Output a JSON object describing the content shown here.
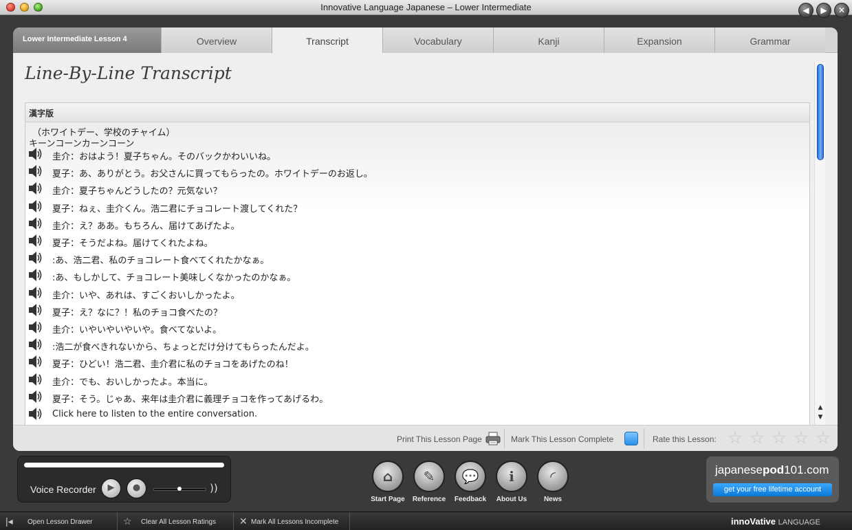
{
  "window": {
    "title": "Innovative Language Japanese – Lower Intermediate",
    "back_icon": "back-arrow",
    "forward_icon": "forward-arrow",
    "close_icon": "close-x"
  },
  "tabs": {
    "lesson_label": "Lower Intermediate Lesson 4",
    "items": [
      {
        "label": "Overview"
      },
      {
        "label": "Transcript"
      },
      {
        "label": "Vocabulary"
      },
      {
        "label": "Kanji"
      },
      {
        "label": "Expansion"
      },
      {
        "label": "Grammar"
      }
    ],
    "active": "Transcript"
  },
  "main": {
    "heading": "Line-By-Line Transcript",
    "box_header": "漢字版",
    "intro_lines": [
      "（ホワイトデー、学校のチャイム）",
      "キーンコーンカーンコーン"
    ],
    "lines": [
      "圭介：おはよう！夏子ちゃん。そのバックかわいいね。",
      "夏子：あ、ありがとう。お父さんに買ってもらったの。ホワイトデーのお返し。",
      "圭介：夏子ちゃんどうしたの？元気ない？",
      "夏子：ねぇ、圭介くん。浩二君にチョコレート渡してくれた？",
      "圭介：え？ああ。もちろん、届けてあげたよ。",
      "夏子：そうだよね。届けてくれたよね。",
      ":あ、浩二君、私のチョコレート食べてくれたかなぁ。",
      ":あ、もしかして、チョコレート美味しくなかったのかなぁ。",
      "圭介：いや、あれは、すごくおいしかったよ。",
      "夏子：え？なに？！私のチョコ食べたの？",
      "圭介：いやいやいやいや。食べてないよ。",
      ":浩二が食べきれないから、ちょっとだけ分けてもらったんだよ。",
      "夏子：ひどい！浩二君、圭介君に私のチョコをあげたのね！",
      "圭介：でも、おいしかったよ。本当に。",
      "夏子：そう。じゃあ、来年は圭介君に義理チョコを作ってあげるわ。",
      "Click here to listen to the entire conversation."
    ],
    "speaker_icon": "speaker-icon"
  },
  "bottom_bar": {
    "print_label": "Print This Lesson Page",
    "complete_label": "Mark This Lesson Complete",
    "rate_label": "Rate this Lesson:",
    "rating": 0,
    "rating_max": 5
  },
  "recorder": {
    "label": "Voice Recorder",
    "volume_level": 0.5
  },
  "nav": [
    {
      "label": "Start Page",
      "icon": "home-icon"
    },
    {
      "label": "Reference",
      "icon": "feather-icon"
    },
    {
      "label": "Feedback",
      "icon": "speech-bubble-icon"
    },
    {
      "label": "About Us",
      "icon": "info-icon"
    },
    {
      "label": "News",
      "icon": "rss-icon"
    }
  ],
  "brand": {
    "site_prefix": "japanese",
    "site_bold": "pod",
    "site_suffix": "101.com",
    "cta": "get your free lifetime account"
  },
  "statusbar": {
    "open_drawer": "Open Lesson Drawer",
    "clear_ratings": "Clear All Lesson Ratings",
    "mark_incomplete": "Mark All Lessons Incomplete",
    "footer_brand_main": "innoVative",
    "footer_brand_small": "LANGUAGE"
  },
  "colors": {
    "accent_blue": "#2a8fe6",
    "panel_bg": "#efefef",
    "chrome_dark": "#3a3a3a"
  }
}
